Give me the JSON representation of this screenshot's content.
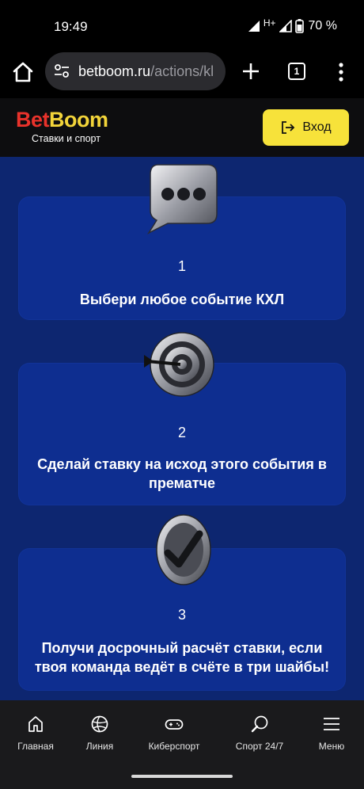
{
  "status_bar": {
    "time": "19:49",
    "network": "H+",
    "battery": "70 %"
  },
  "browser": {
    "url_host": "betboom.ru",
    "url_path": "/actions/kl",
    "tab_count": "1"
  },
  "header": {
    "logo_bet": "Bet",
    "logo_boom": "Boom",
    "logo_tagline": "Ставки и спорт",
    "login_label": "Вход"
  },
  "steps": [
    {
      "number": "1",
      "text": "Выбери любое событие КХЛ",
      "icon": "chat-bubble-icon"
    },
    {
      "number": "2",
      "text": "Сделай ставку на исход этого события в прематче",
      "icon": "target-dart-icon"
    },
    {
      "number": "3",
      "text": "Получи досрочный расчёт ставки, если твоя команда ведёт в счёте в три шайбы!",
      "icon": "checkmark-coin-icon"
    }
  ],
  "bottom_nav": [
    {
      "label": "Главная",
      "icon": "home-icon"
    },
    {
      "label": "Линия",
      "icon": "ball-icon"
    },
    {
      "label": "Киберспорт",
      "icon": "gamepad-icon"
    },
    {
      "label": "Спорт 24/7",
      "icon": "ping-pong-icon"
    },
    {
      "label": "Меню",
      "icon": "menu-icon"
    }
  ],
  "colors": {
    "main_bg": "#0d2670",
    "card_bg": "#0e2e90",
    "login_button": "#f7e23a",
    "logo_red": "#e8322b",
    "logo_yellow": "#f2d43a"
  }
}
